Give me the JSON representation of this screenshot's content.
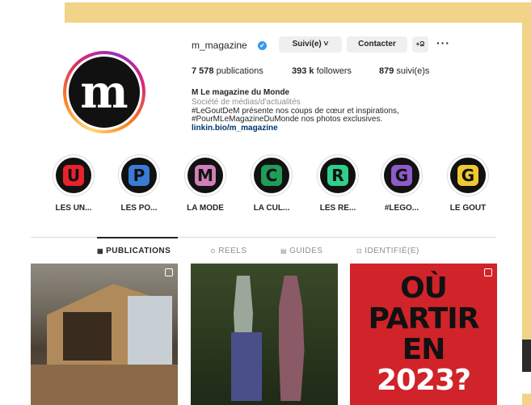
{
  "profile": {
    "username": "m_magazine",
    "verified_mark": "✔",
    "avatar_letter": "m",
    "follow_label": "Suivi(e) ˅",
    "contact_label": "Contacter",
    "suggest_icon": "+Ձ",
    "more_icon": "···"
  },
  "stats": {
    "posts": "7 578",
    "posts_label": "publications",
    "followers": "393 k",
    "followers_label": "followers",
    "following": "879",
    "following_label": "suivi(e)s"
  },
  "bio": {
    "name": "M Le magazine du Monde",
    "category": "Société de médias/d'actualités",
    "line1": "#LeGoutDeM présente nos coups de cœur et inspirations,",
    "line2": "#PourMLeMagazineDuMonde nos photos exclusives.",
    "link": "linkin.bio/m_magazine"
  },
  "highlights": [
    {
      "label": "LES UN...",
      "glyph": "U",
      "color": "#e8232a"
    },
    {
      "label": "LES PO...",
      "glyph": "P",
      "color": "#3a7bd5"
    },
    {
      "label": "LA MODE",
      "glyph": "M",
      "color": "#d17fb8"
    },
    {
      "label": "LA CUL...",
      "glyph": "C",
      "color": "#1f9c5a"
    },
    {
      "label": "LES RE...",
      "glyph": "R",
      "color": "#2ecf8a"
    },
    {
      "label": "#LEGO...",
      "glyph": "G",
      "color": "#8e5bc9"
    },
    {
      "label": "LE GOUT",
      "glyph": "G",
      "color": "#f2c832"
    }
  ],
  "tabs": [
    {
      "label": "PUBLICATIONS",
      "icon": "▦"
    },
    {
      "label": "REELS",
      "icon": "⊙"
    },
    {
      "label": "GUIDES",
      "icon": "▤"
    },
    {
      "label": "IDENTIFIÉ(E)",
      "icon": "⊡"
    }
  ],
  "posts": {
    "post3_line1": "OÙ",
    "post3_line2": "PARTIR",
    "post3_line3": "EN",
    "post3_line4": "2023?"
  },
  "colors": {
    "accent_frame": "#f1d488",
    "link": "#00376b",
    "verified": "#3897f0"
  }
}
